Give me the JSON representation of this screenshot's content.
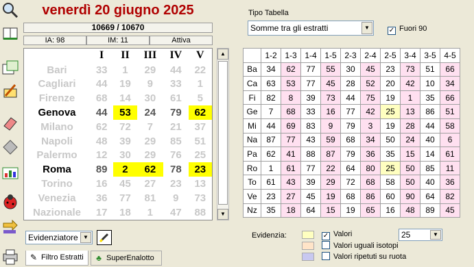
{
  "header": {
    "date": "venerdì 20 giugno 2025",
    "concorso": "10669 / 10670",
    "ia": "IA: 98",
    "im": "IM: 11",
    "status": "Attiva"
  },
  "estrazioni": {
    "columns": [
      "I",
      "II",
      "III",
      "IV",
      "V"
    ],
    "rows": [
      {
        "wheel": "Bari",
        "nums": [
          "33",
          "1",
          "29",
          "44",
          "22"
        ],
        "active": false,
        "hl": []
      },
      {
        "wheel": "Cagliari",
        "nums": [
          "44",
          "19",
          "9",
          "33",
          "1"
        ],
        "active": false,
        "hl": []
      },
      {
        "wheel": "Firenze",
        "nums": [
          "68",
          "14",
          "30",
          "61",
          "5"
        ],
        "active": false,
        "hl": []
      },
      {
        "wheel": "Genova",
        "nums": [
          "44",
          "53",
          "24",
          "79",
          "62"
        ],
        "active": true,
        "hl": [
          1,
          4
        ]
      },
      {
        "wheel": "Milano",
        "nums": [
          "62",
          "72",
          "7",
          "21",
          "37"
        ],
        "active": false,
        "hl": []
      },
      {
        "wheel": "Napoli",
        "nums": [
          "48",
          "39",
          "29",
          "85",
          "51"
        ],
        "active": false,
        "hl": []
      },
      {
        "wheel": "Palermo",
        "nums": [
          "12",
          "30",
          "29",
          "76",
          "25"
        ],
        "active": false,
        "hl": []
      },
      {
        "wheel": "Roma",
        "nums": [
          "89",
          "2",
          "62",
          "78",
          "23"
        ],
        "active": true,
        "hl": [
          1,
          2,
          4
        ]
      },
      {
        "wheel": "Torino",
        "nums": [
          "16",
          "45",
          "27",
          "23",
          "13"
        ],
        "active": false,
        "hl": []
      },
      {
        "wheel": "Venezia",
        "nums": [
          "36",
          "77",
          "81",
          "9",
          "73"
        ],
        "active": false,
        "hl": []
      },
      {
        "wheel": "Nazionale",
        "nums": [
          "17",
          "18",
          "1",
          "47",
          "88"
        ],
        "active": false,
        "hl": []
      }
    ]
  },
  "controls": {
    "evidenziatore": "Evidenziatore",
    "tab_filtro": "Filtro Estratti",
    "tab_super": "SuperEnalotto"
  },
  "right": {
    "tipo_label": "Tipo Tabella",
    "tipo_value": "Somme tra gli estratti",
    "fuori90_label": "Fuori 90",
    "fuori90_checked": true,
    "columns": [
      "1-2",
      "1-3",
      "1-4",
      "1-5",
      "2-3",
      "2-4",
      "2-5",
      "3-4",
      "3-5",
      "4-5"
    ],
    "rows": [
      {
        "label": "Ba",
        "vals": [
          "34",
          "62",
          "77",
          "55",
          "30",
          "45",
          "23",
          "73",
          "51",
          "66"
        ]
      },
      {
        "label": "Ca",
        "vals": [
          "63",
          "53",
          "77",
          "45",
          "28",
          "52",
          "20",
          "42",
          "10",
          "34"
        ]
      },
      {
        "label": "Fi",
        "vals": [
          "82",
          "8",
          "39",
          "73",
          "44",
          "75",
          "19",
          "1",
          "35",
          "66"
        ]
      },
      {
        "label": "Ge",
        "vals": [
          "7",
          "68",
          "33",
          "16",
          "77",
          "42",
          "25",
          "13",
          "86",
          "51"
        ]
      },
      {
        "label": "Mi",
        "vals": [
          "44",
          "69",
          "83",
          "9",
          "79",
          "3",
          "19",
          "28",
          "44",
          "58"
        ]
      },
      {
        "label": "Na",
        "vals": [
          "87",
          "77",
          "43",
          "59",
          "68",
          "34",
          "50",
          "24",
          "40",
          "6"
        ]
      },
      {
        "label": "Pa",
        "vals": [
          "62",
          "41",
          "88",
          "87",
          "79",
          "36",
          "35",
          "15",
          "14",
          "61"
        ]
      },
      {
        "label": "Ro",
        "vals": [
          "1",
          "61",
          "77",
          "22",
          "64",
          "80",
          "25",
          "50",
          "85",
          "11"
        ]
      },
      {
        "label": "To",
        "vals": [
          "61",
          "43",
          "39",
          "29",
          "72",
          "68",
          "58",
          "50",
          "40",
          "36"
        ]
      },
      {
        "label": "Ve",
        "vals": [
          "23",
          "27",
          "45",
          "19",
          "68",
          "86",
          "60",
          "90",
          "64",
          "82"
        ]
      },
      {
        "label": "Nz",
        "vals": [
          "35",
          "18",
          "64",
          "15",
          "19",
          "65",
          "16",
          "48",
          "89",
          "45"
        ]
      }
    ],
    "yellow_cells": [
      [
        3,
        6
      ],
      [
        7,
        6
      ]
    ],
    "evidenzia_label": "Evidenzia:",
    "opt_valori": "Valori",
    "opt_isotopi": "Valori uguali isotopi",
    "opt_ripetuti": "Valori ripetuti su ruota",
    "valori_checked": true,
    "valore_sel": "25",
    "colors": {
      "pink": "#ffe0f0",
      "yellow_hl": "#ffff00",
      "light_yellow": "#ffffc0",
      "date_red": "#b00000"
    }
  }
}
